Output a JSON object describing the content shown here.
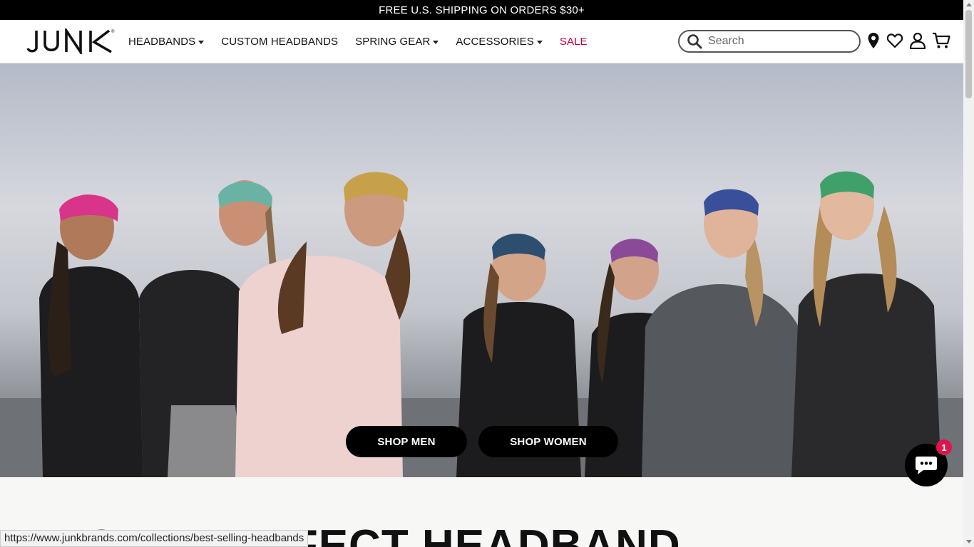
{
  "announcement": {
    "text": "FREE U.S. SHIPPING ON ORDERS $30+"
  },
  "brand": {
    "logo_text": "JUNK",
    "logo_mark": "®"
  },
  "nav": {
    "items": [
      {
        "label": "HEADBANDS",
        "has_dropdown": true
      },
      {
        "label": "CUSTOM HEADBANDS",
        "has_dropdown": false
      },
      {
        "label": "SPRING GEAR",
        "has_dropdown": true
      },
      {
        "label": "ACCESSORIES",
        "has_dropdown": true
      },
      {
        "label": "SALE",
        "has_dropdown": false,
        "color": "#c4003a"
      }
    ]
  },
  "search": {
    "placeholder": "Search",
    "value": ""
  },
  "header_icons": [
    "location-pin-icon",
    "heart-icon",
    "account-icon",
    "cart-icon"
  ],
  "hero": {
    "buttons": [
      {
        "label": "SHOP MEN"
      },
      {
        "label": "SHOP WOMEN"
      }
    ]
  },
  "section": {
    "headline": "YOUR PERFECT HEADBAND"
  },
  "chat": {
    "badge_count": "1",
    "icon": "chat-bubble-icon"
  },
  "status_bar": {
    "url": "https://www.junkbrands.com/collections/best-selling-headbands"
  },
  "colors": {
    "accent_sale": "#c4003a",
    "badge": "#e0144d",
    "announcement_bg": "#000000"
  }
}
